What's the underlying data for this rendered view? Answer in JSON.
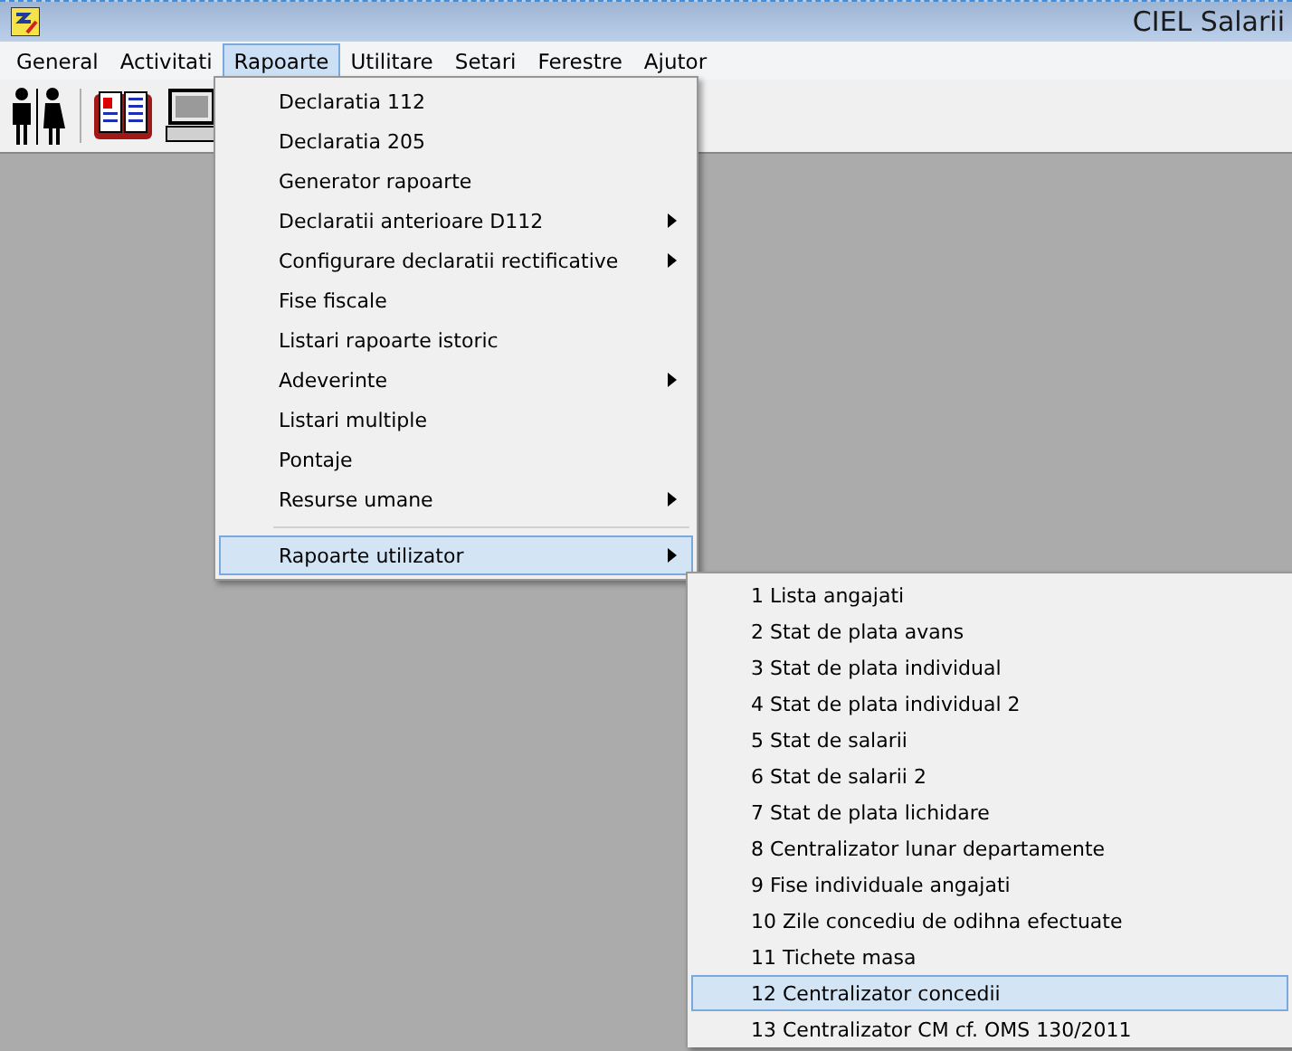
{
  "window": {
    "title": "CIEL Salarii"
  },
  "menu_bar": [
    {
      "label": "General",
      "selected": false
    },
    {
      "label": "Activitati",
      "selected": false
    },
    {
      "label": "Rapoarte",
      "selected": true
    },
    {
      "label": "Utilitare",
      "selected": false
    },
    {
      "label": "Setari",
      "selected": false
    },
    {
      "label": "Ferestre",
      "selected": false
    },
    {
      "label": "Ajutor",
      "selected": false
    }
  ],
  "dropdown": [
    {
      "kind": "item",
      "label": "Declaratia 112",
      "submenu": false,
      "selected": false
    },
    {
      "kind": "item",
      "label": "Declaratia 205",
      "submenu": false,
      "selected": false
    },
    {
      "kind": "item",
      "label": "Generator rapoarte",
      "submenu": false,
      "selected": false
    },
    {
      "kind": "item",
      "label": "Declaratii anterioare D112",
      "submenu": true,
      "selected": false
    },
    {
      "kind": "item",
      "label": "Configurare declaratii rectificative",
      "submenu": true,
      "selected": false
    },
    {
      "kind": "item",
      "label": "Fise fiscale",
      "submenu": false,
      "selected": false
    },
    {
      "kind": "item",
      "label": "Listari rapoarte istoric",
      "submenu": false,
      "selected": false
    },
    {
      "kind": "item",
      "label": "Adeverinte",
      "submenu": true,
      "selected": false
    },
    {
      "kind": "item",
      "label": "Listari multiple",
      "submenu": false,
      "selected": false
    },
    {
      "kind": "item",
      "label": "Pontaje",
      "submenu": false,
      "selected": false
    },
    {
      "kind": "item",
      "label": "Resurse umane",
      "submenu": true,
      "selected": false
    },
    {
      "kind": "separator"
    },
    {
      "kind": "item",
      "label": "Rapoarte utilizator",
      "submenu": true,
      "selected": true
    }
  ],
  "submenu": [
    {
      "label": "1 Lista angajati",
      "selected": false
    },
    {
      "label": "2 Stat de plata avans",
      "selected": false
    },
    {
      "label": "3 Stat de plata individual",
      "selected": false
    },
    {
      "label": "4 Stat de plata individual 2",
      "selected": false
    },
    {
      "label": "5 Stat de salarii",
      "selected": false
    },
    {
      "label": "6 Stat de salarii 2",
      "selected": false
    },
    {
      "label": "7 Stat de plata lichidare",
      "selected": false
    },
    {
      "label": "8 Centralizator lunar departamente",
      "selected": false
    },
    {
      "label": "9 Fise individuale angajati",
      "selected": false
    },
    {
      "label": "10 Zile concediu de odihna efectuate",
      "selected": false
    },
    {
      "label": "11 Tichete masa",
      "selected": false
    },
    {
      "label": "12 Centralizator concedii",
      "selected": true
    },
    {
      "label": "13 Centralizator CM cf. OMS 130/2011",
      "selected": false
    }
  ]
}
